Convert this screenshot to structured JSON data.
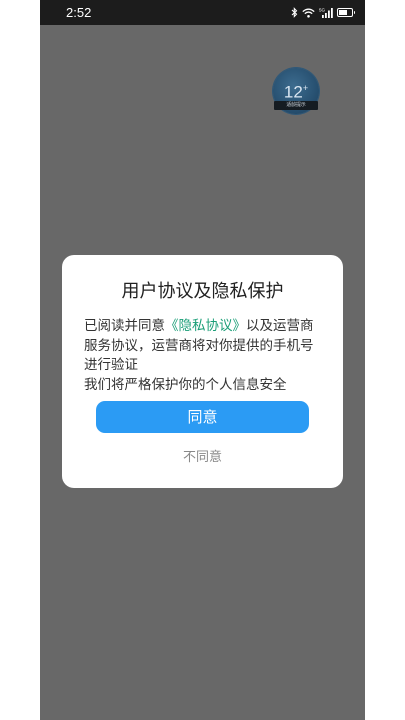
{
  "status_bar": {
    "time": "2:52",
    "icons": [
      "bluetooth-icon",
      "wifi-icon",
      "signal-icon",
      "battery-icon"
    ],
    "network_label": "5G"
  },
  "age_badge": {
    "number": "12",
    "plus": "+",
    "label": "适龄提示"
  },
  "dialog": {
    "title": "用户协议及隐私保护",
    "body_prefix": "已阅读并同意",
    "policy_link": "《隐私协议》",
    "body_suffix": "以及运营商服务协议，运营商将对你提供的手机号进行验证",
    "body_line2": "我们将严格保护你的个人信息安全",
    "agree_label": "同意",
    "disagree_label": "不同意"
  },
  "colors": {
    "overlay": "#686868",
    "status_bar": "#1c1c1c",
    "primary": "#2b9bf4",
    "link": "#1a9e77"
  }
}
